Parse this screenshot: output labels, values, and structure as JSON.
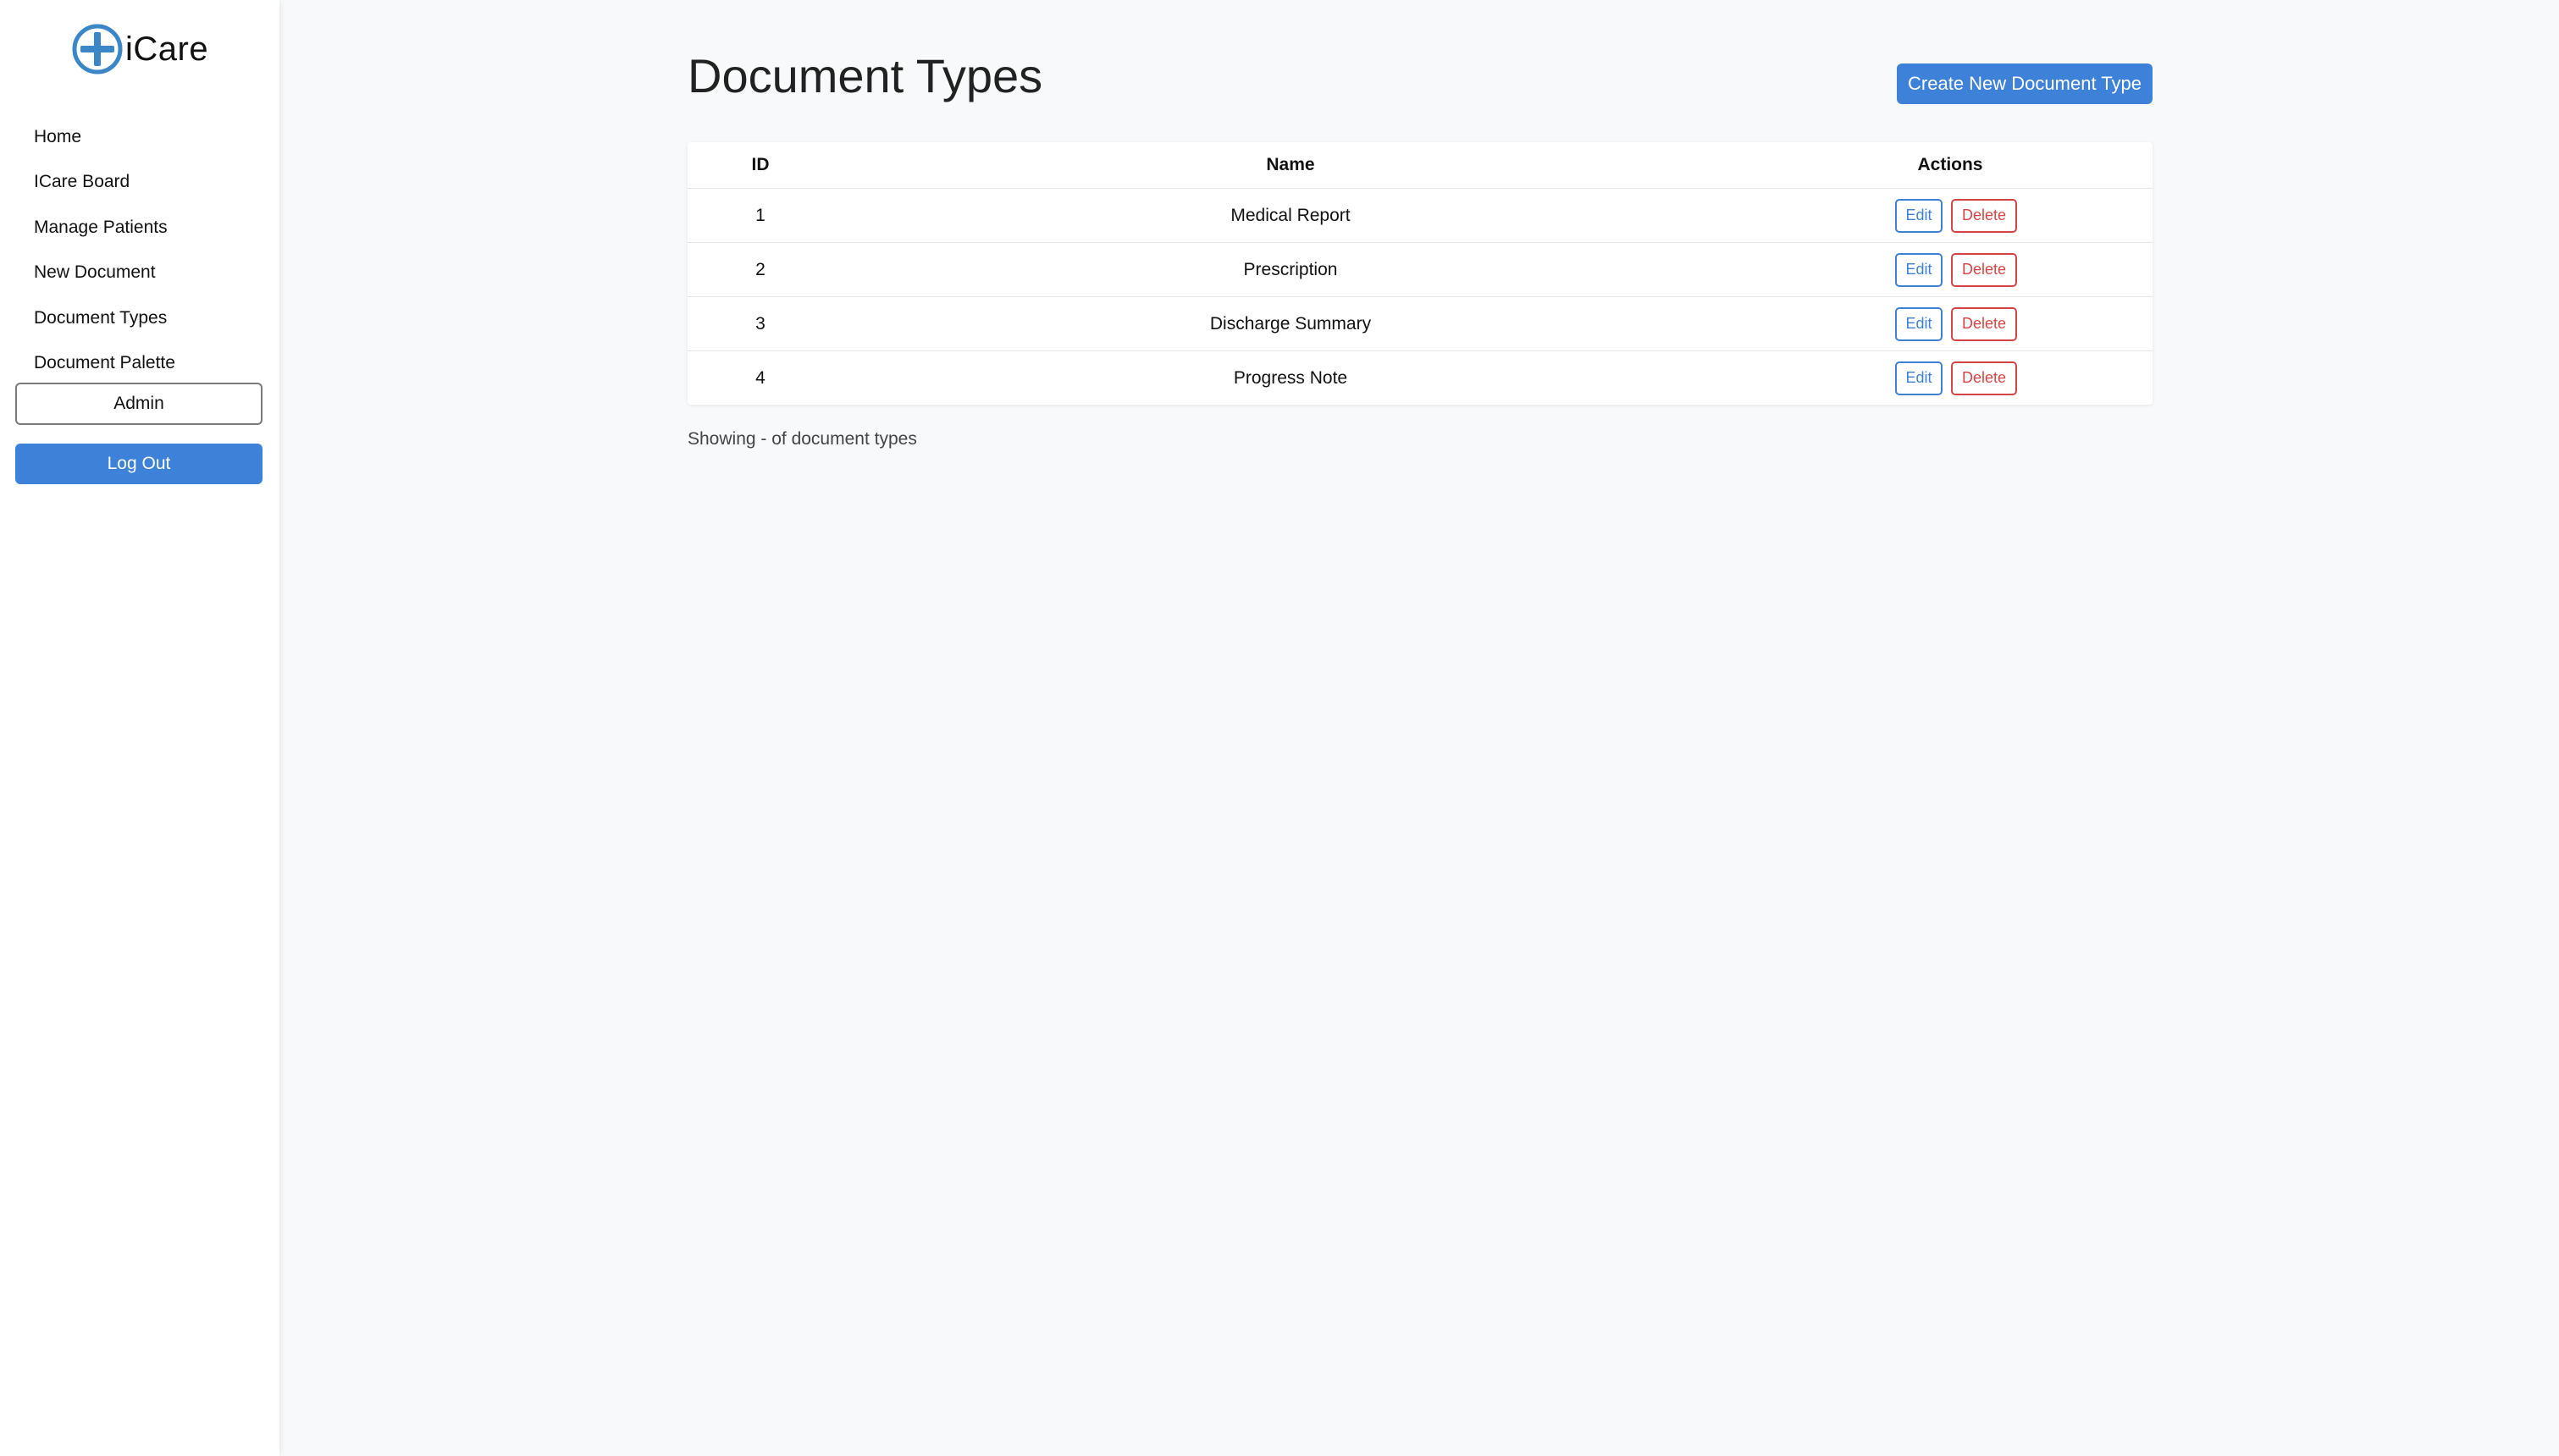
{
  "app": {
    "logo_text": "iCare",
    "logo_icon": "plus-circle-icon",
    "accent_color": "#3e81d8"
  },
  "sidebar": {
    "items": [
      {
        "label": "Home"
      },
      {
        "label": "ICare Board"
      },
      {
        "label": "Manage Patients"
      },
      {
        "label": "New Document"
      },
      {
        "label": "Document Types"
      },
      {
        "label": "Document Palette"
      }
    ],
    "admin_label": "Admin",
    "logout_label": "Log Out"
  },
  "main": {
    "title": "Document Types",
    "create_label": "Create New Document Type",
    "table": {
      "headers": {
        "id": "ID",
        "name": "Name",
        "actions": "Actions"
      },
      "rows": [
        {
          "id": "1",
          "name": "Medical Report",
          "edit": "Edit",
          "delete": "Delete"
        },
        {
          "id": "2",
          "name": "Prescription",
          "edit": "Edit",
          "delete": "Delete"
        },
        {
          "id": "3",
          "name": "Discharge Summary",
          "edit": "Edit",
          "delete": "Delete"
        },
        {
          "id": "4",
          "name": "Progress Note",
          "edit": "Edit",
          "delete": "Delete"
        }
      ]
    },
    "footer_text": "Showing - of document types"
  }
}
